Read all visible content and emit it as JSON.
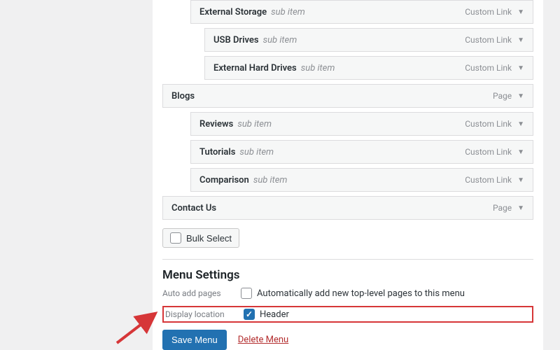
{
  "menu_items": [
    {
      "title": "External Storage",
      "sub": true,
      "type": "Custom Link",
      "indent": 1
    },
    {
      "title": "USB Drives",
      "sub": true,
      "type": "Custom Link",
      "indent": 2
    },
    {
      "title": "External Hard Drives",
      "sub": true,
      "type": "Custom Link",
      "indent": 2
    },
    {
      "title": "Blogs",
      "sub": false,
      "type": "Page",
      "indent": 0
    },
    {
      "title": "Reviews",
      "sub": true,
      "type": "Custom Link",
      "indent": 1
    },
    {
      "title": "Tutorials",
      "sub": true,
      "type": "Custom Link",
      "indent": 1
    },
    {
      "title": "Comparison",
      "sub": true,
      "type": "Custom Link",
      "indent": 1
    },
    {
      "title": "Contact Us",
      "sub": false,
      "type": "Page",
      "indent": 0
    }
  ],
  "sub_item_text": "sub item",
  "bulk_select_label": "Bulk Select",
  "section_title": "Menu Settings",
  "auto_add": {
    "label": "Auto add pages",
    "option": "Automatically add new top-level pages to this menu",
    "checked": false
  },
  "display_location": {
    "label": "Display location",
    "option": "Header",
    "checked": true
  },
  "actions": {
    "save": "Save Menu",
    "delete": "Delete Menu"
  }
}
